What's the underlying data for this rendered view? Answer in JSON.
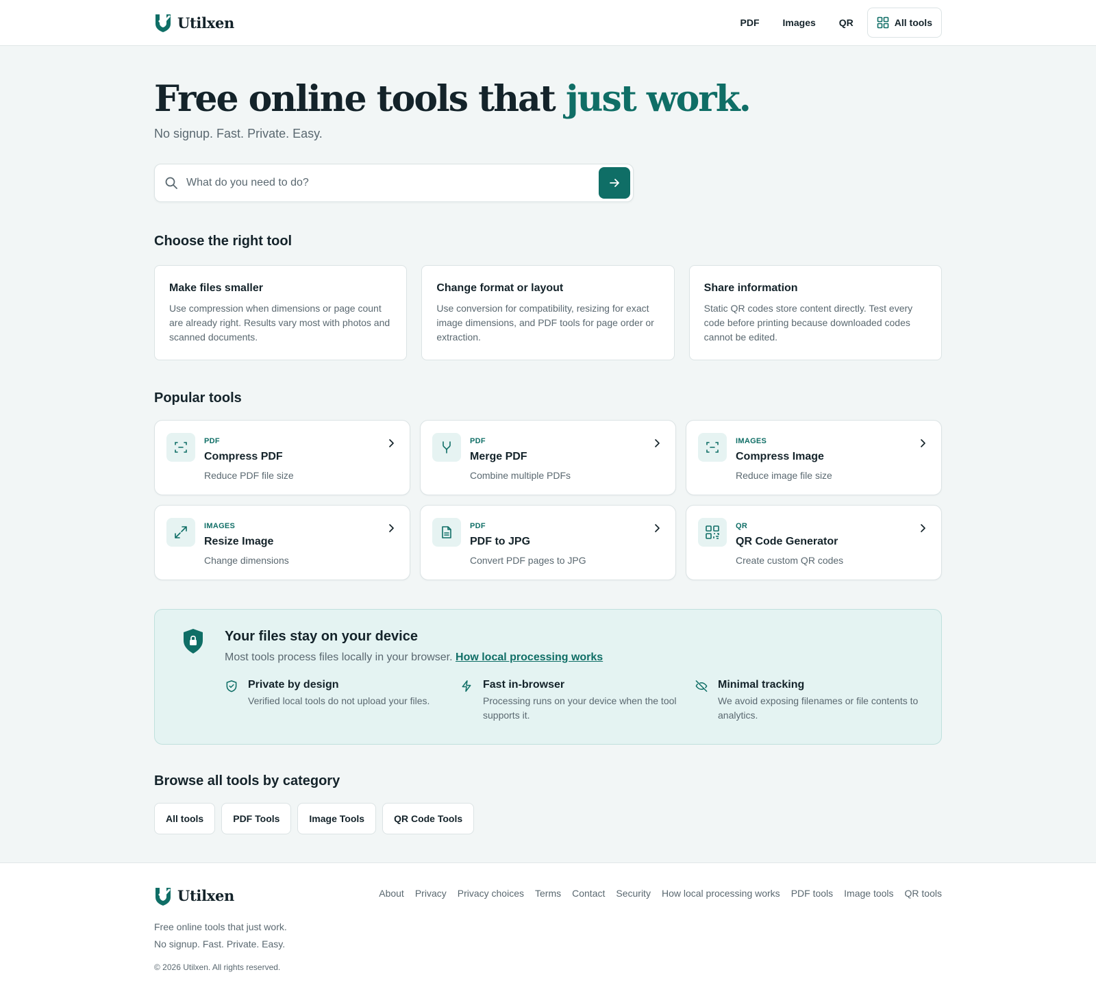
{
  "brand": {
    "name": "Utilxen",
    "accent": "#0f6e66"
  },
  "nav": {
    "pdf": "PDF",
    "images": "Images",
    "qr": "QR",
    "all_tools": "All tools"
  },
  "hero": {
    "title_main": "Free online tools that ",
    "title_accent": "just work.",
    "subtitle": "No signup. Fast. Private. Easy.",
    "search_placeholder": "What do you need to do?"
  },
  "choose": {
    "heading": "Choose the right tool",
    "cards": [
      {
        "title": "Make files smaller",
        "text": "Use compression when dimensions or page count are already right. Results vary most with photos and scanned documents."
      },
      {
        "title": "Change format or layout",
        "text": "Use conversion for compatibility, resizing for exact image dimensions, and PDF tools for page order or extraction."
      },
      {
        "title": "Share information",
        "text": "Static QR codes store content directly. Test every code before printing because downloaded codes cannot be edited."
      }
    ]
  },
  "popular": {
    "heading": "Popular tools",
    "tools": [
      {
        "category": "PDF",
        "name": "Compress PDF",
        "desc": "Reduce PDF file size",
        "icon": "compress-icon"
      },
      {
        "category": "PDF",
        "name": "Merge PDF",
        "desc": "Combine multiple PDFs",
        "icon": "merge-icon"
      },
      {
        "category": "IMAGES",
        "name": "Compress Image",
        "desc": "Reduce image file size",
        "icon": "compress-icon"
      },
      {
        "category": "IMAGES",
        "name": "Resize Image",
        "desc": "Change dimensions",
        "icon": "resize-icon"
      },
      {
        "category": "PDF",
        "name": "PDF to JPG",
        "desc": "Convert PDF pages to JPG",
        "icon": "file-icon"
      },
      {
        "category": "QR",
        "name": "QR Code Generator",
        "desc": "Create custom QR codes",
        "icon": "qr-icon"
      }
    ]
  },
  "privacy": {
    "title": "Your files stay on your device",
    "desc": "Most tools process files locally in your browser. ",
    "link": "How local processing works",
    "features": [
      {
        "title": "Private by design",
        "text": "Verified local tools do not upload your files."
      },
      {
        "title": "Fast in-browser",
        "text": "Processing runs on your device when the tool supports it."
      },
      {
        "title": "Minimal tracking",
        "text": "We avoid exposing filenames or file contents to analytics."
      }
    ]
  },
  "categories": {
    "heading": "Browse all tools by category",
    "items": [
      "All tools",
      "PDF Tools",
      "Image Tools",
      "QR Code Tools"
    ]
  },
  "footer": {
    "tagline1": "Free online tools that just work.",
    "tagline2": "No signup. Fast. Private. Easy.",
    "copyright": "© 2026 Utilxen. All rights reserved.",
    "links": [
      "About",
      "Privacy",
      "Privacy choices",
      "Terms",
      "Contact",
      "Security",
      "How local processing works",
      "PDF tools",
      "Image tools",
      "QR tools"
    ]
  }
}
